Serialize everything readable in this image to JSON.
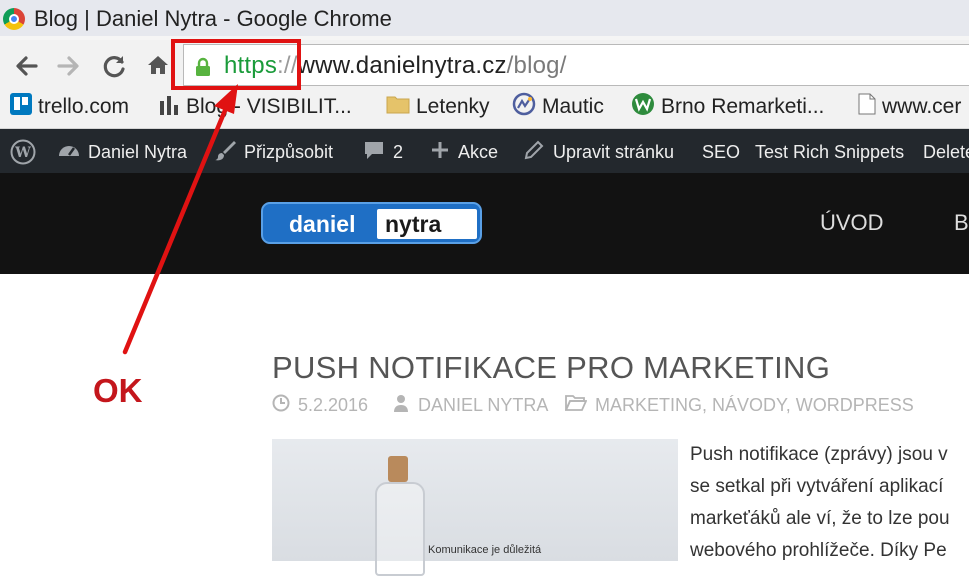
{
  "window": {
    "title": "Blog | Daniel Nytra - Google Chrome"
  },
  "omnibox": {
    "scheme": "https",
    "separator": "://",
    "host": "www.danielnytra.cz",
    "path": "/blog/"
  },
  "bookmarks": [
    {
      "label": "trello.com",
      "icon": "trello-icon"
    },
    {
      "label": "Blog - VISIBILIT...",
      "icon": "bar-chart-icon"
    },
    {
      "label": "Letenky",
      "icon": "folder-icon"
    },
    {
      "label": "Mautic",
      "icon": "mautic-icon"
    },
    {
      "label": "Brno Remarketi...",
      "icon": "w-logo-icon"
    },
    {
      "label": "www.cer",
      "icon": "page-icon"
    }
  ],
  "wp_admin_bar": {
    "site": "Daniel Nytra",
    "customize": "Přizpůsobit",
    "comments": "2",
    "new": "Akce",
    "edit": "Upravit stránku",
    "seo": "SEO",
    "rich_snippets": "Test Rich Snippets",
    "delete": "Delete"
  },
  "site": {
    "logo_left": "daniel",
    "logo_right": "nytra",
    "menu": [
      "ÚVOD",
      "B"
    ]
  },
  "post": {
    "title": "PUSH NOTIFIKACE PRO MARKETING",
    "date": "5.2.2016",
    "author": "DANIEL NYTRA",
    "categories": "MARKETING, NÁVODY, WORDPRESS",
    "image_caption": "Komunikace je důležitá",
    "text_lines": [
      "Push notifikace (zprávy) jsou v",
      "se setkal při vytváření aplikací",
      "markeťáků ale ví, že to lze pou",
      "webového prohlížeče. Díky Pe"
    ]
  },
  "annotation": {
    "label": "OK",
    "color": "#e01212"
  }
}
